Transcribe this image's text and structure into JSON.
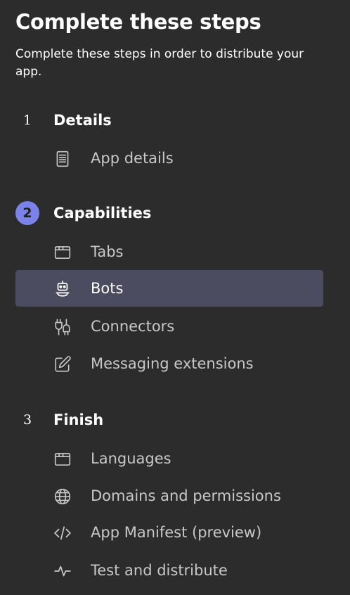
{
  "header": {
    "title": "Complete these steps",
    "subtitle": "Complete these steps in order to distribute your app."
  },
  "steps": [
    {
      "number": "1",
      "label": "Details",
      "active": false,
      "items": [
        {
          "label": "App details",
          "icon": "document-list-icon",
          "selected": false
        }
      ]
    },
    {
      "number": "2",
      "label": "Capabilities",
      "active": true,
      "items": [
        {
          "label": "Tabs",
          "icon": "tab-window-icon",
          "selected": false
        },
        {
          "label": "Bots",
          "icon": "bot-icon",
          "selected": true
        },
        {
          "label": "Connectors",
          "icon": "connector-plug-icon",
          "selected": false
        },
        {
          "label": "Messaging extensions",
          "icon": "edit-pencil-icon",
          "selected": false
        }
      ]
    },
    {
      "number": "3",
      "label": "Finish",
      "active": false,
      "items": [
        {
          "label": "Languages",
          "icon": "tab-window-icon",
          "selected": false
        },
        {
          "label": "Domains and permissions",
          "icon": "globe-icon",
          "selected": false
        },
        {
          "label": "App Manifest (preview)",
          "icon": "code-brackets-icon",
          "selected": false
        },
        {
          "label": "Test and distribute",
          "icon": "pulse-icon",
          "selected": false
        }
      ]
    }
  ],
  "colors": {
    "background": "#2d2c2c",
    "active_step": "#7b83eb",
    "selected_item_bg": "#4b4c60",
    "item_text": "#c8c8c8"
  }
}
